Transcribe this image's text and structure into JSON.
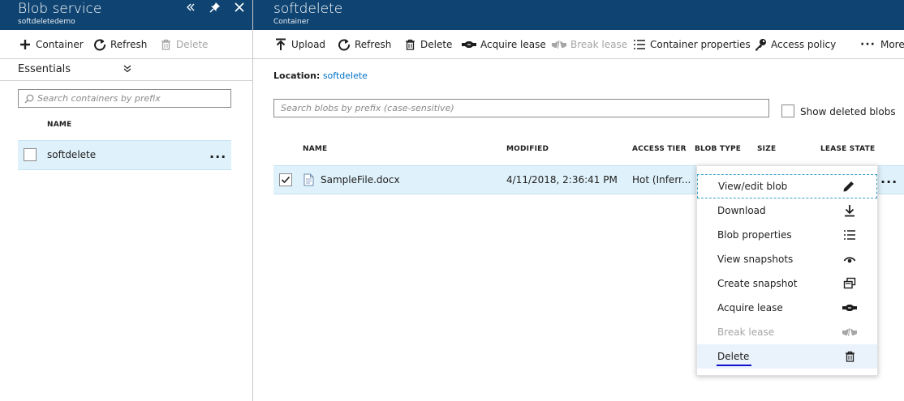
{
  "left_panel": {
    "title": "Blob service",
    "subtitle": "softdeletedemo",
    "toolbar": {
      "container_label": "Container",
      "refresh_label": "Refresh",
      "delete_label": "Delete"
    },
    "essentials_label": "Essentials",
    "search_placeholder": "Search containers by prefix",
    "column_name": "NAME",
    "containers": [
      {
        "name": "softdelete",
        "more": "..."
      }
    ]
  },
  "right_panel": {
    "title": "softdelete",
    "subtitle": "Container",
    "toolbar": {
      "upload_label": "Upload",
      "refresh_label": "Refresh",
      "delete_label": "Delete",
      "acquire_lease_label": "Acquire lease",
      "break_lease_label": "Break lease",
      "container_properties_label": "Container properties",
      "access_policy_label": "Access policy",
      "more_label": "More"
    },
    "location_label": "Location:",
    "location_value": "softdelete",
    "search_placeholder": "Search blobs by prefix (case-sensitive)",
    "show_deleted_label": "Show deleted blobs",
    "columns": {
      "name": "NAME",
      "modified": "MODIFIED",
      "access_tier": "ACCESS TIER",
      "blob_type": "BLOB TYPE",
      "size": "SIZE",
      "lease_state": "LEASE STATE"
    },
    "blobs": [
      {
        "name": "SampleFile.docx",
        "modified": "4/11/2018, 2:36:41 PM",
        "access_tier": "Hot (Inferr...",
        "more": "..."
      }
    ]
  },
  "context_menu": {
    "items": [
      {
        "label": "View/edit blob",
        "icon": "pencil-icon"
      },
      {
        "label": "Download",
        "icon": "download-icon"
      },
      {
        "label": "Blob properties",
        "icon": "list-icon"
      },
      {
        "label": "View snapshots",
        "icon": "eye-icon"
      },
      {
        "label": "Create snapshot",
        "icon": "snapshot-icon"
      },
      {
        "label": "Acquire lease",
        "icon": "handshake-icon"
      },
      {
        "label": "Break lease",
        "icon": "break-lease-icon"
      },
      {
        "label": "Delete",
        "icon": "trash-icon"
      }
    ]
  },
  "colors": {
    "header": "#0f4472",
    "selected_row": "#dff1fa",
    "link": "#0072c6",
    "disabled": "#a6a6a6"
  }
}
